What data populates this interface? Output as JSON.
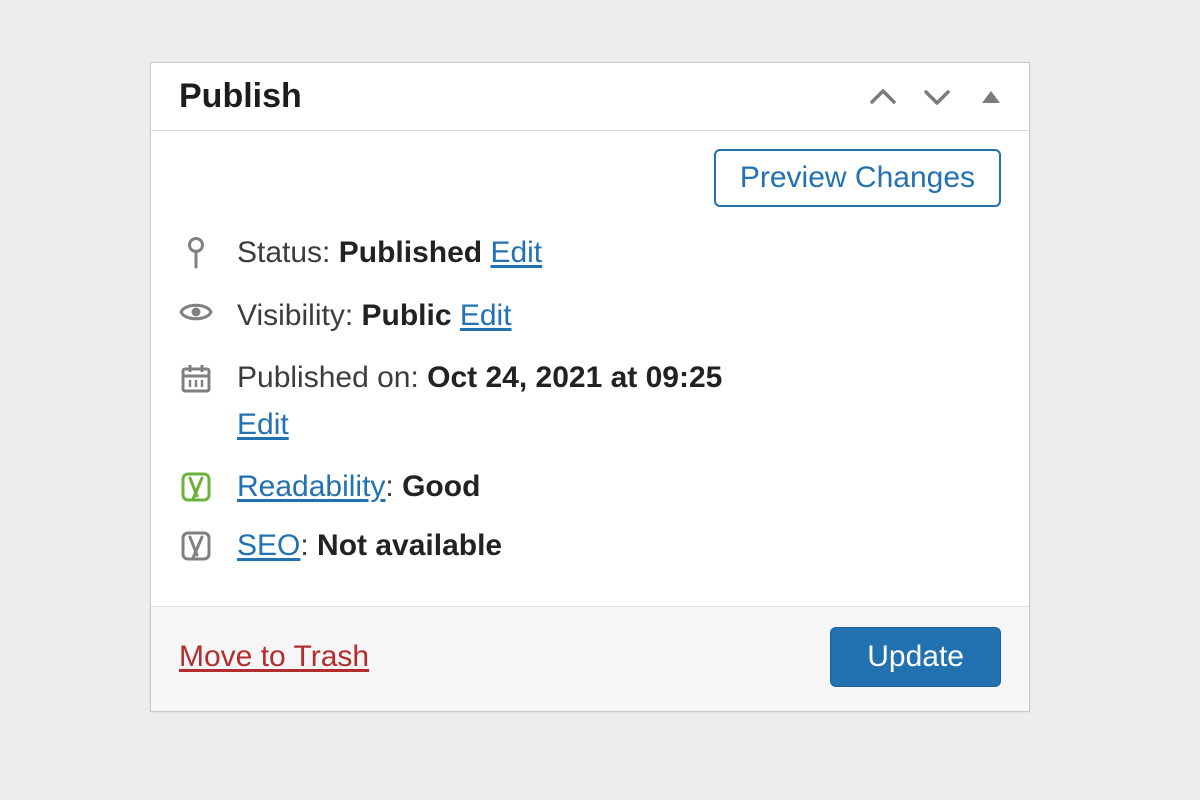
{
  "panel": {
    "title": "Publish",
    "preview_button": "Preview Changes",
    "status": {
      "label": "Status:",
      "value": "Published",
      "edit": "Edit"
    },
    "visibility": {
      "label": "Visibility:",
      "value": "Public",
      "edit": "Edit"
    },
    "published": {
      "label": "Published on:",
      "value": "Oct 24, 2021 at 09:25",
      "edit": "Edit"
    },
    "readability": {
      "link": "Readability",
      "value": "Good"
    },
    "seo": {
      "link": "SEO",
      "value": "Not available"
    },
    "trash": "Move to Trash",
    "update": "Update"
  },
  "colors": {
    "link": "#2271b1",
    "danger": "#b32d2e",
    "icon_gray": "#808080",
    "yoast_green": "#6bb23a"
  }
}
